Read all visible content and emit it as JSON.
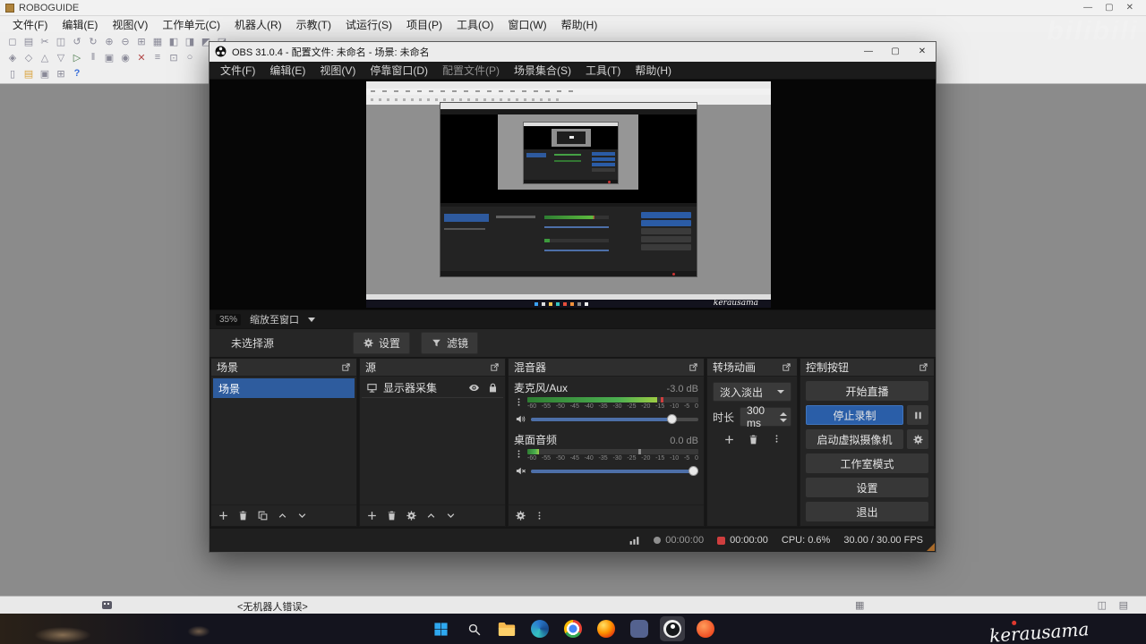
{
  "roboguide": {
    "title": "ROBOGUIDE",
    "menus": [
      "文件(F)",
      "编辑(E)",
      "视图(V)",
      "工作单元(C)",
      "机器人(R)",
      "示教(T)",
      "试运行(S)",
      "项目(P)",
      "工具(O)",
      "窗口(W)",
      "帮助(H)"
    ],
    "toolbar_rows": [
      [
        "◻",
        "▤",
        "✂",
        "◫",
        "↺",
        "↻",
        "⊕",
        "⊖",
        "⊞",
        "▦",
        "◧",
        "◨",
        "◩",
        "◪"
      ],
      [
        "◈",
        "◇",
        "△",
        "▽",
        "▷",
        "‖",
        "▣",
        "◉",
        "✕",
        "≡",
        "⊡",
        "○"
      ],
      [
        "▯",
        "▤",
        "▣",
        "⊞",
        "?"
      ]
    ],
    "status_icons": [
      "▦",
      "◫",
      "▤"
    ],
    "status_message": "<无机器人错误>"
  },
  "obs": {
    "title": "OBS 31.0.4 - 配置文件: 未命名 - 场景: 未命名",
    "menus": [
      "文件(F)",
      "编辑(E)",
      "视图(V)",
      "停靠窗口(D)",
      "配置文件(P)",
      "场景集合(S)",
      "工具(T)",
      "帮助(H)"
    ],
    "zoom_level": "35%",
    "zoom_fit": "缩放至窗口",
    "no_source": "未选择源",
    "settings_btn": "设置",
    "filters_btn": "滤镜",
    "scenes": {
      "title": "场景",
      "item": "场景"
    },
    "sources": {
      "title": "源",
      "item": "显示器采集"
    },
    "mixer": {
      "title": "混音器",
      "scale": [
        "-60",
        "-55",
        "-50",
        "-45",
        "-40",
        "-35",
        "-30",
        "-25",
        "-20",
        "-15",
        "-10",
        "-5",
        "0"
      ],
      "channels": [
        {
          "name": "麦克风/Aux",
          "db": "-3.0 dB"
        },
        {
          "name": "桌面音频",
          "db": "0.0 dB"
        }
      ]
    },
    "transitions": {
      "title": "转场动画",
      "selected": "淡入淡出",
      "duration_label": "时长",
      "duration": "300 ms"
    },
    "controls": {
      "title": "控制按钮",
      "buttons": [
        "开始直播",
        "停止录制",
        "启动虚拟摄像机",
        "工作室模式",
        "设置",
        "退出"
      ]
    },
    "status": {
      "stream_time": "00:00:00",
      "rec_time": "00:00:00",
      "cpu": "CPU: 0.6%",
      "fps": "30.00 / 30.00 FPS"
    }
  },
  "watermark": {
    "signature": "kerausama",
    "corner": "bilibili"
  },
  "taskbar": {
    "icons": [
      "windows-start",
      "search",
      "file-explorer",
      "edge",
      "chrome",
      "firefox",
      "app-indigo",
      "obs-studio",
      "app-orange"
    ]
  }
}
